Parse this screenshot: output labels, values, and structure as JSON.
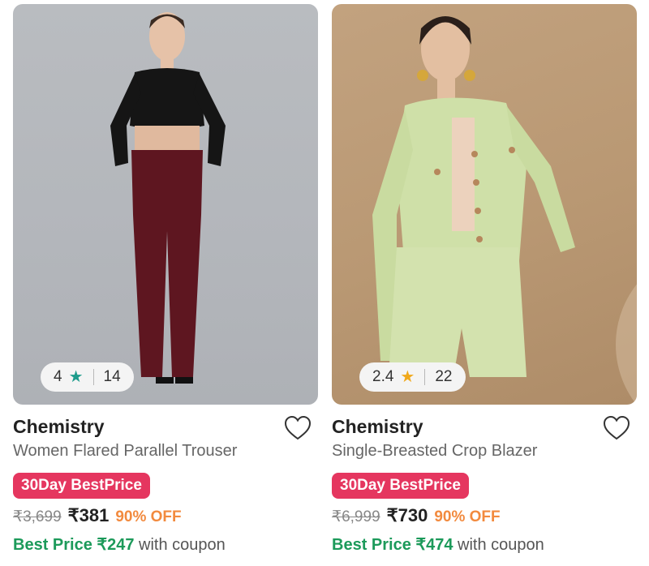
{
  "products": [
    {
      "brand": "Chemistry",
      "title": "Women Flared Parallel Trouser",
      "rating": "4",
      "star_color": "#1e9c8c",
      "reviews": "14",
      "badge": "30Day BestPrice",
      "mrp": "₹3,699",
      "price": "₹381",
      "discount": "90% OFF",
      "best_label": "Best Price ₹247",
      "best_suffix": "with coupon"
    },
    {
      "brand": "Chemistry",
      "title": "Single-Breasted Crop Blazer",
      "rating": "2.4",
      "star_color": "#f0a81a",
      "reviews": "22",
      "badge": "30Day BestPrice",
      "mrp": "₹6,999",
      "price": "₹730",
      "discount": "90% OFF",
      "best_label": "Best Price ₹474",
      "best_suffix": "with coupon"
    }
  ],
  "colors": {
    "badge": "#e5365f",
    "best_price": "#1c9a5a",
    "discount": "#f28a3e"
  },
  "icons": {
    "wishlist": "heart-outline-icon",
    "rating": "star-icon"
  }
}
